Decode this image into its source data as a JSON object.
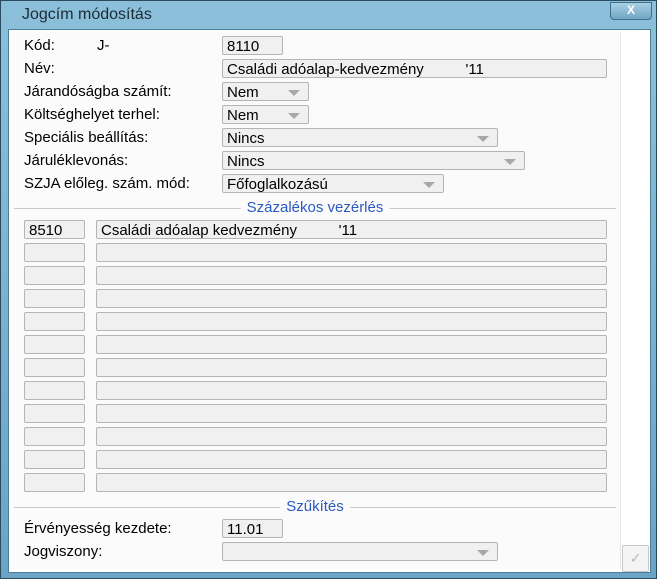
{
  "window": {
    "title": "Jogcím módosítás",
    "close_label": "X"
  },
  "form": {
    "kod_label": "Kód:",
    "kod_prefix": "J-",
    "kod_value": "8110",
    "nev_label": "Név:",
    "nev_value": "Családi adóalap-kedvezmény          '11",
    "jarandosag_label": "Járandóságba számít:",
    "jarandosag_value": "Nem",
    "koltseghely_label": "Költséghelyet terhel:",
    "koltseghely_value": "Nem",
    "specialis_label": "Speciális beállítás:",
    "specialis_value": "Nincs",
    "jarulek_label": "Járuléklevonás:",
    "jarulek_value": "Nincs",
    "szja_label": "SZJA előleg. szám. mód:",
    "szja_value": "Főfoglalkozású"
  },
  "percent_section": {
    "title": "Százalékos vezérlés",
    "rows": [
      {
        "code": "8510",
        "name": "Családi adóalap kedvezmény          '11"
      },
      {
        "code": "",
        "name": ""
      },
      {
        "code": "",
        "name": ""
      },
      {
        "code": "",
        "name": ""
      },
      {
        "code": "",
        "name": ""
      },
      {
        "code": "",
        "name": ""
      },
      {
        "code": "",
        "name": ""
      },
      {
        "code": "",
        "name": ""
      },
      {
        "code": "",
        "name": ""
      },
      {
        "code": "",
        "name": ""
      },
      {
        "code": "",
        "name": ""
      },
      {
        "code": "",
        "name": ""
      }
    ]
  },
  "filter_section": {
    "title": "Szűkítés",
    "ervenyesseg_label": "Érvényesség kezdete:",
    "ervenyesseg_value": "11.01",
    "jogviszony_label": "Jogviszony:",
    "jogviszony_value": ""
  },
  "ok_button": {
    "label": "✓"
  }
}
